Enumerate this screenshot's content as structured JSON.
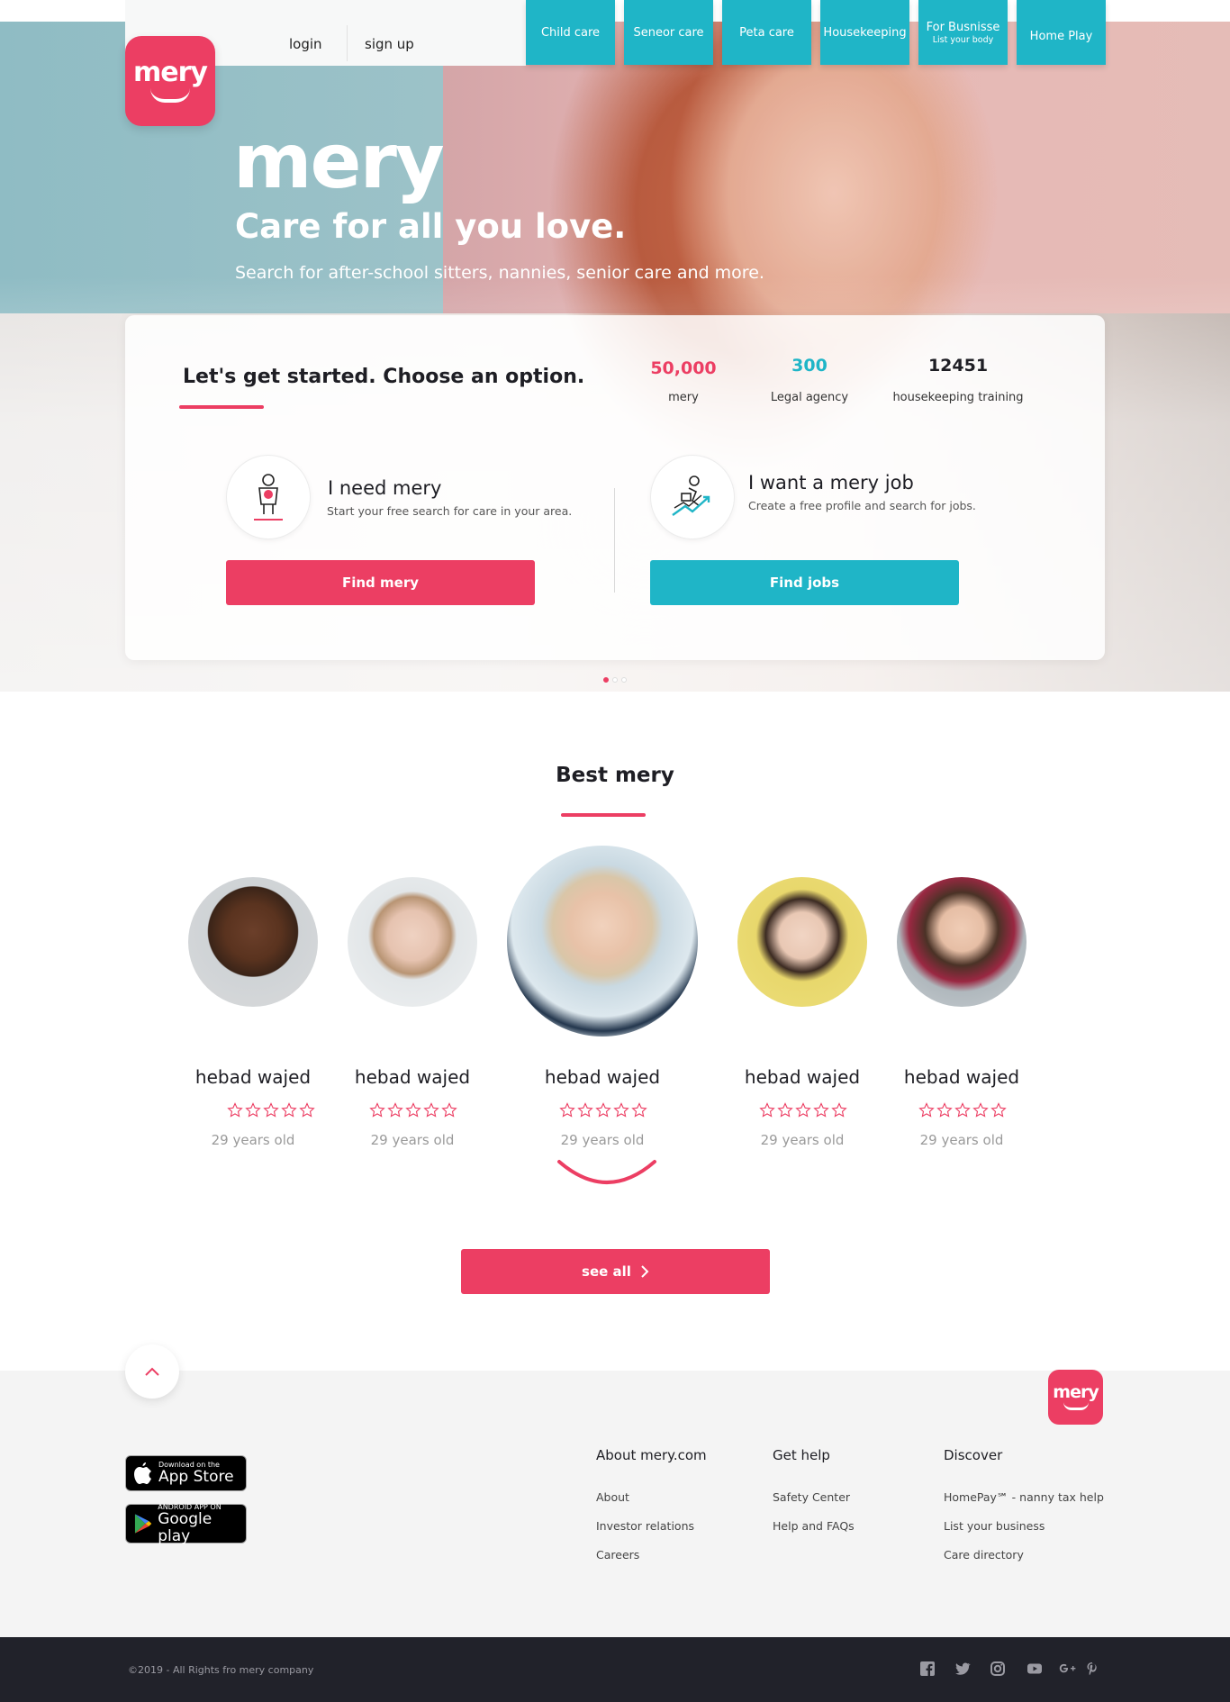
{
  "header": {
    "login": "login",
    "signup": "sign up",
    "logo": "mery",
    "nav": [
      {
        "label": "Child care"
      },
      {
        "label": "Seneor care"
      },
      {
        "label": "Peta care"
      },
      {
        "label": "Housekeeping"
      },
      {
        "label": "For Busnisse",
        "sub": "List your body"
      },
      {
        "label": "Home Play"
      }
    ]
  },
  "hero": {
    "brand": "mery",
    "tagline": "Care for all you love.",
    "subtitle": "Search for after-school sitters, nannies, senior care and more."
  },
  "card": {
    "title": "Let's get started. Choose an option.",
    "stats": [
      {
        "value": "50,000",
        "label": "mery",
        "color": "#ec3e63"
      },
      {
        "value": "300",
        "label": "Legal agency",
        "color": "#1fb5c7"
      },
      {
        "value": "12451",
        "label": "housekeeping training",
        "color": "#1e1e24"
      }
    ],
    "need": {
      "title": "I need mery",
      "desc": "Start your free search for care in your area.",
      "button": "Find mery",
      "icon": "caregiver-icon"
    },
    "job": {
      "title": "I want a mery job",
      "desc": "Create a free profile and search for jobs.",
      "button": "Find jobs",
      "icon": "career-growth-icon"
    },
    "slides": {
      "count": 3,
      "active": 1
    }
  },
  "best": {
    "title": "Best mery",
    "people": [
      {
        "name": "hebad wajed",
        "age": "29 years old",
        "rating": 0
      },
      {
        "name": "hebad wajed",
        "age": "29 years old",
        "rating": 0
      },
      {
        "name": "hebad wajed",
        "age": "29 years old",
        "rating": 0
      },
      {
        "name": "hebad wajed",
        "age": "29 years old",
        "rating": 0
      },
      {
        "name": "hebad wajed",
        "age": "29 years old",
        "rating": 0
      }
    ],
    "see_all": "see all"
  },
  "footer": {
    "logo": "mery",
    "app_store": {
      "small": "Download on the",
      "big": "App Store"
    },
    "google_play": {
      "small": "ANDROID APP ON",
      "big": "Google play"
    },
    "columns": [
      {
        "title": "About mery.com",
        "links": [
          "About",
          "Investor relations",
          "Careers"
        ]
      },
      {
        "title": "Get help",
        "links": [
          "Safety Center",
          "Help and FAQs"
        ]
      },
      {
        "title": "Discover",
        "links": [
          "HomePay℠ - nanny tax help",
          "List your business",
          "Care directory"
        ]
      }
    ],
    "copyright": "©2019 - All Rights fro mery company",
    "social": [
      "facebook-icon",
      "twitter-icon",
      "instagram-icon",
      "youtube-icon",
      "google-plus-icon",
      "pinterest-icon"
    ]
  },
  "colors": {
    "accent": "#ec3e63",
    "secondary": "#1fb5c7",
    "dark": "#21222a"
  }
}
